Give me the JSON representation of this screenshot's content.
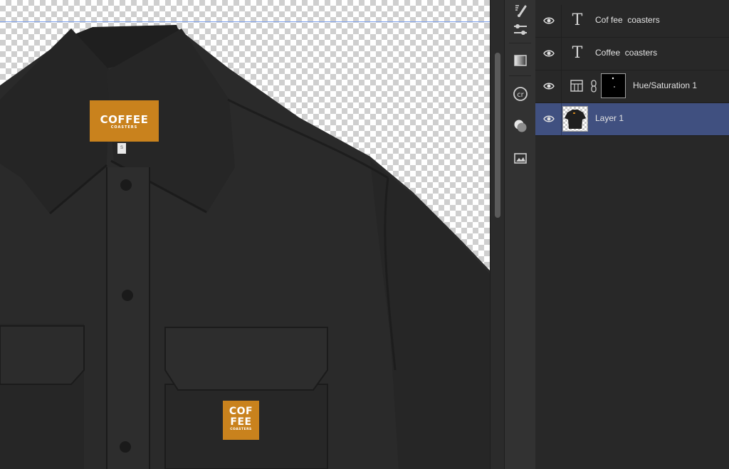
{
  "canvas": {
    "collar_label": {
      "brand": "COFFEE",
      "sub": "COASTERS"
    },
    "size_label": "S",
    "pocket_label": {
      "line1": "COF",
      "line2": "FEE",
      "sub": "COASTERS"
    },
    "guide_color": "#7ea2ee",
    "label_color": "#c9821d"
  },
  "tools": [
    {
      "icon": "brush-settings-icon"
    },
    {
      "icon": "adjustment-sliders-icon"
    },
    {
      "icon": "gradient-swatch-icon"
    },
    {
      "icon": "creative-cloud-libraries-icon"
    },
    {
      "icon": "blend-circles-icon"
    },
    {
      "icon": "image-frame-icon"
    }
  ],
  "layers": [
    {
      "name": "Cof fee  coasters",
      "kind": "text",
      "visible": true,
      "selected": false
    },
    {
      "name": "Coffee  coasters",
      "kind": "text",
      "visible": true,
      "selected": false
    },
    {
      "name": "Hue/Saturation 1",
      "kind": "adjustment",
      "visible": true,
      "selected": false
    },
    {
      "name": "Layer 1",
      "kind": "pixel",
      "visible": true,
      "selected": true
    }
  ],
  "colors": {
    "selection": "#405080",
    "panel": "#282828"
  }
}
